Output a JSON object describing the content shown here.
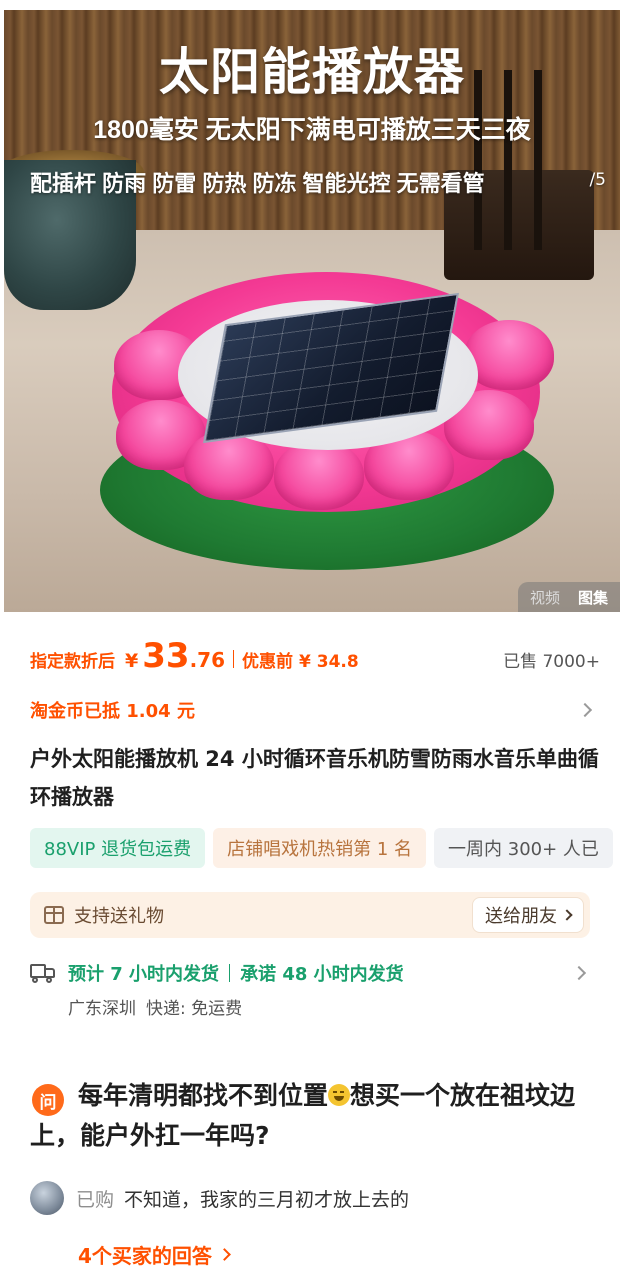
{
  "hero": {
    "title": "太阳能播放器",
    "subtitle": "1800毫安  无太阳下满电可播放三天三夜",
    "features": "配插杆 防雨 防雷 防热 防冻 智能光控 无需看管",
    "counter": "/5",
    "tabs": [
      {
        "label": "视频",
        "active": false
      },
      {
        "label": "图集",
        "active": true
      }
    ]
  },
  "price": {
    "label": "指定款折后",
    "currency": "¥",
    "integer": "33",
    "decimal": ".76",
    "original_label": "优惠前",
    "original_price": "¥ 34.8",
    "sold": "已售 7000+"
  },
  "coin": {
    "text": "淘金币已抵 1.04 元"
  },
  "product": {
    "title": "户外太阳能播放机 24 小时循环音乐机防雪防雨水音乐单曲循环播放器"
  },
  "tags": [
    {
      "label": "88VIP 退货包运费",
      "style": "green"
    },
    {
      "label": "店铺唱戏机热销第 1 名",
      "style": "orange"
    },
    {
      "label": "一周内 300+ 人已",
      "style": "grey"
    }
  ],
  "gift": {
    "text": "支持送礼物",
    "button": "送给朋友"
  },
  "shipping": {
    "estimate": "预计 7 小时内发货",
    "promise": "承诺 48 小时内发货",
    "origin": "广东深圳",
    "delivery": "快递: 免运费"
  },
  "qa": {
    "badge": "问",
    "question_part1": "每年清明都找不到位置",
    "question_part2": "想买一个放在祖坟边",
    "question_part3": "上，能户外扛一年吗?",
    "answer_status": "已购",
    "answer_text": "不知道，我家的三月初才放上去的",
    "more": "4个买家的回答"
  },
  "colors": {
    "accent": "#ff5000",
    "green": "#1aa06d",
    "gift_bg": "#fdf1e5"
  }
}
